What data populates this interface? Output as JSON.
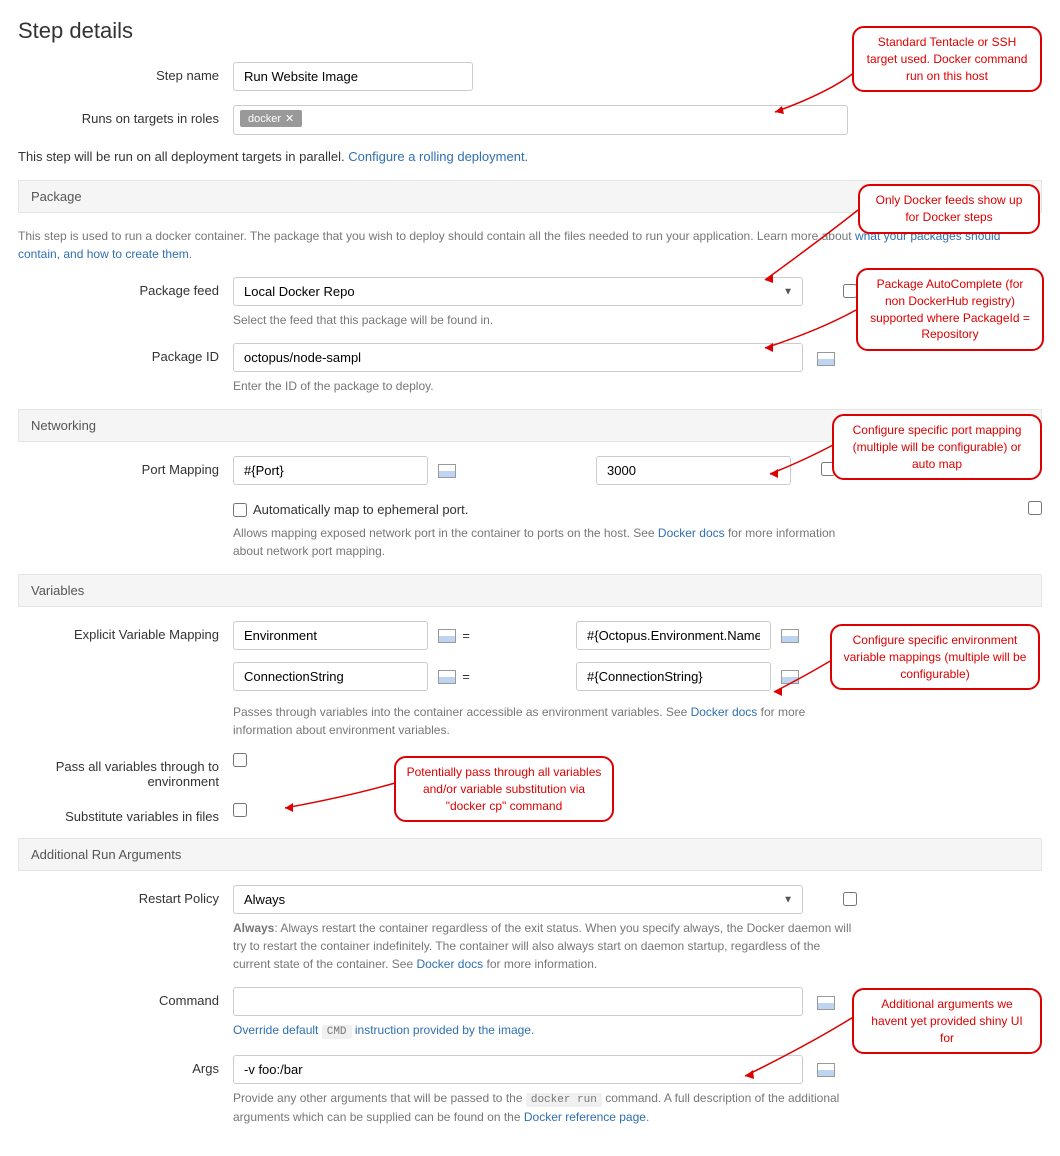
{
  "title": "Step details",
  "step_name": {
    "label": "Step name",
    "value": "Run Website Image"
  },
  "runs_on": {
    "label": "Runs on targets in roles",
    "tag": "docker"
  },
  "parallel_text": "This step will be run on all deployment targets in parallel. ",
  "parallel_link": "Configure a rolling deployment.",
  "sections": {
    "package": {
      "header": "Package",
      "intro_a": "This step is used to run a docker container. The package that you wish to deploy should contain all the files needed to run your application. Learn more about ",
      "intro_link": "what your packages should contain, and how to create them",
      "feed": {
        "label": "Package feed",
        "value": "Local Docker Repo",
        "help": "Select the feed that this package will be found in."
      },
      "id": {
        "label": "Package ID",
        "value": "octopus/node-sampl",
        "help": "Enter the ID of the package to deploy."
      }
    },
    "networking": {
      "header": "Networking",
      "port": {
        "label": "Port Mapping",
        "host": "#{Port}",
        "container": "3000"
      },
      "auto": {
        "label": "Automatically map to ephemeral port."
      },
      "help_a": "Allows mapping exposed network port in the container to ports on the host. See ",
      "help_link": "Docker docs",
      "help_b": " for more information about network port mapping."
    },
    "variables": {
      "header": "Variables",
      "label": "Explicit Variable Mapping",
      "rows": [
        {
          "key": "Environment",
          "val": "#{Octopus.Environment.Name}"
        },
        {
          "key": "ConnectionString",
          "val": "#{ConnectionString}"
        }
      ],
      "help_a": "Passes through variables into the container accessible as environment variables. See ",
      "help_link": "Docker docs",
      "help_b": " for more information about environment variables.",
      "pass_all": "Pass all variables through to environment",
      "substitute": "Substitute variables in files"
    },
    "args": {
      "header": "Additional Run Arguments",
      "restart": {
        "label": "Restart Policy",
        "value": "Always"
      },
      "restart_help_bold": "Always",
      "restart_help_a": ": Always restart the container regardless of the exit status. When you specify always, the Docker daemon will try to restart the container indefinitely. The container will also always start on daemon startup, regardless of the current state of the container. See ",
      "restart_help_link": "Docker docs",
      "restart_help_b": " for more information.",
      "command": {
        "label": "Command",
        "value": "",
        "help_a": "Override default ",
        "help_code": "CMD",
        "help_b": " instruction provided by the image."
      },
      "extra": {
        "label": "Args",
        "value": "-v foo:/bar",
        "help_a": "Provide any other arguments that will be passed to the ",
        "help_code": "docker run",
        "help_b": " command. A full description of the additional arguments which can be supplied can be found on the ",
        "help_link": "Docker reference page",
        "help_c": "."
      }
    }
  },
  "callouts": {
    "c1": "Standard Tentacle or SSH target used. Docker command run on this host",
    "c2": "Only Docker feeds show up for Docker steps",
    "c3": "Package AutoComplete (for non DockerHub registry) supported where PackageId = Repository",
    "c4": "Configure specific port mapping (multiple will be configurable) or auto map",
    "c5": "Configure specific environment variable mappings (multiple will be configurable)",
    "c6": "Potentially pass through all variables and/or variable substitution via \"docker cp\" command",
    "c7": "Additional arguments we havent yet provided shiny UI for"
  }
}
